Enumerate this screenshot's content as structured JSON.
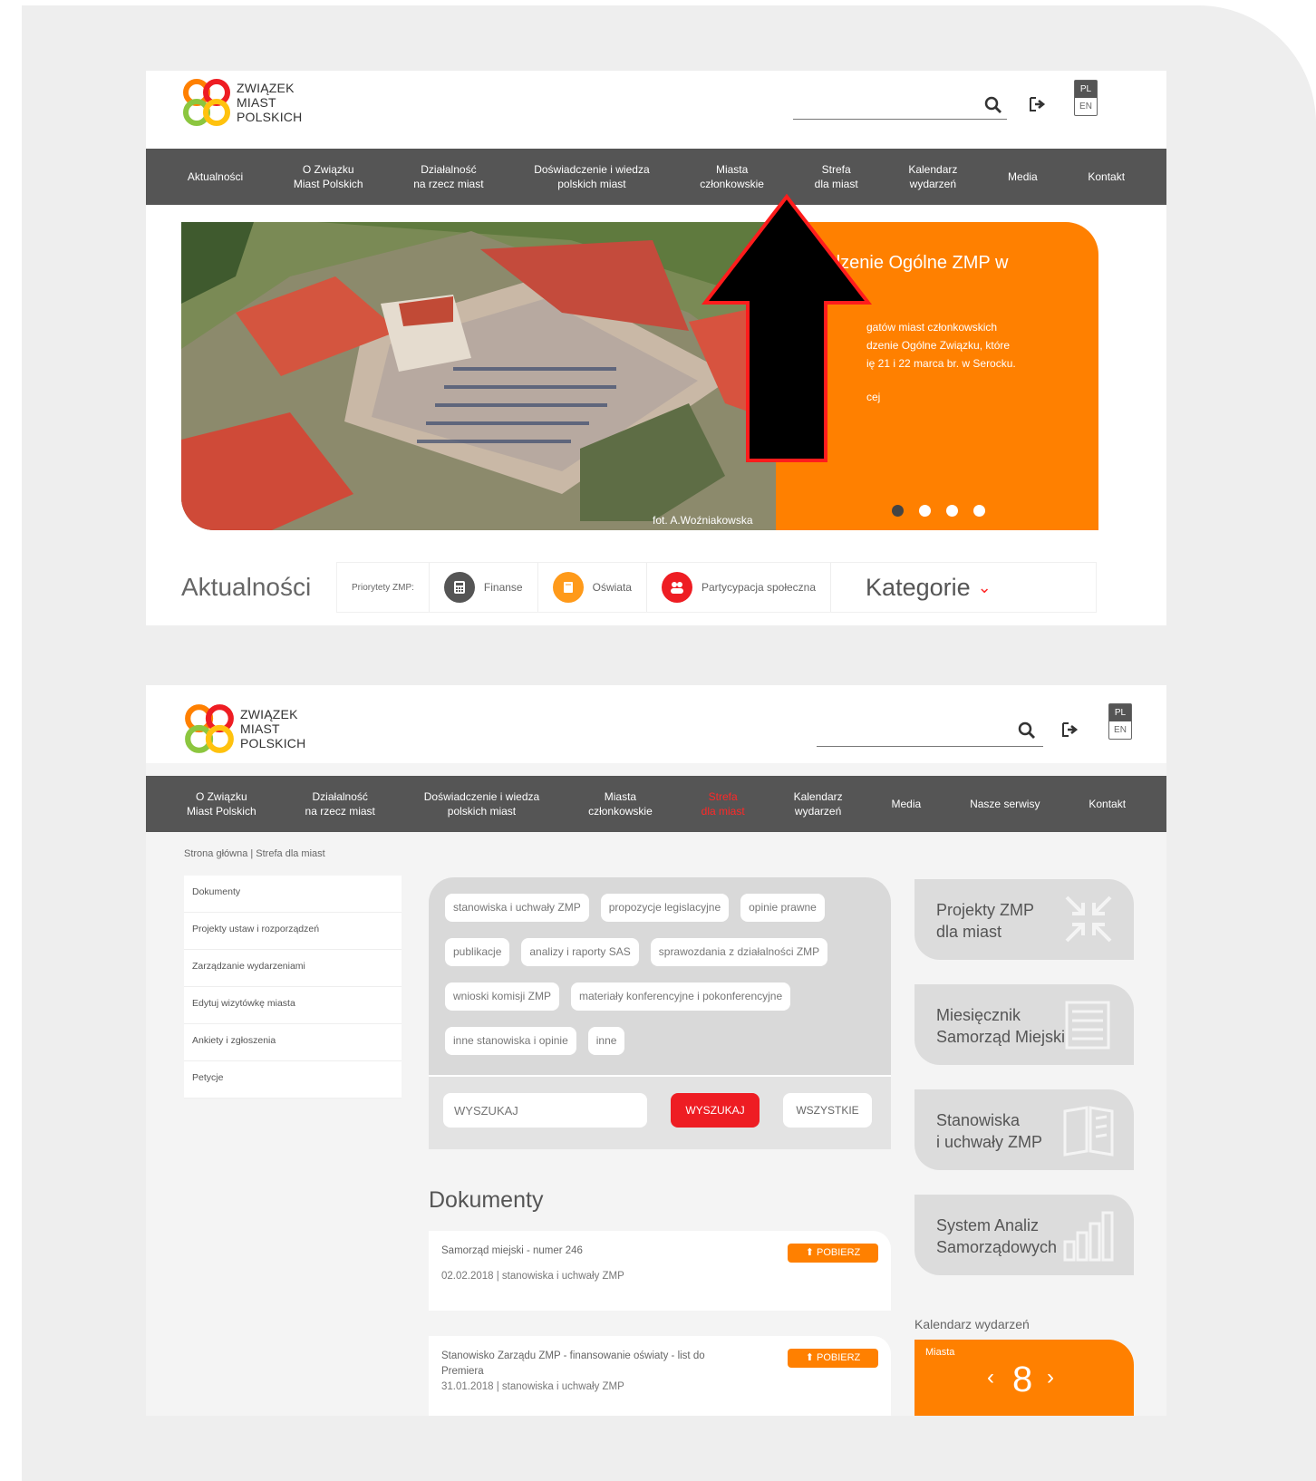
{
  "header": {
    "logo_lines": [
      "ZWIĄZEK",
      "MIAST",
      "POLSKICH"
    ],
    "lang_pl": "PL",
    "lang_en": "EN"
  },
  "nav1": [
    "Aktualności",
    "O Związku\nMiast Polskich",
    "Działalność\nna rzecz miast",
    "Doświadczenie i wiedza\npolskich miast",
    "Miasta\nczłonkowskie",
    "Strefa\ndla miast",
    "Kalendarz\nwydarzeń",
    "Media",
    "Kontakt"
  ],
  "nav2": [
    "O Związku\nMiast Polskich",
    "Działalność\nna rzecz miast",
    "Doświadczenie i wiedza\npolskich miast",
    "Miasta\nczłonkowskie",
    "Strefa\ndla miast",
    "Kalendarz\nwydarzeń",
    "Media",
    "Nasze serwisy",
    "Kontakt"
  ],
  "hero": {
    "title": "dzenie Ogólne ZMP w",
    "text": "gatów miast członkowskich\ndzenie Ogólne Związku, które\nię 21 i 22 marca br. w Serocku.",
    "more": "cej",
    "credit": "fot. A.Woźniakowska"
  },
  "news": {
    "title": "Aktualności",
    "categories": [
      "Priorytety ZMP:",
      "Finanse",
      "Oświata",
      "Partycypacja społeczna"
    ],
    "kategorie": "Kategorie"
  },
  "breadcrumb": "Strona główna  |  Strefa dla miast",
  "side_menu": [
    "Dokumenty",
    "Projekty ustaw i rozporządzeń",
    "Zarządzanie wydarzeniami",
    "Edytuj wizytówkę miasta",
    "Ankiety i zgłoszenia",
    "Petycje"
  ],
  "tags": [
    "stanowiska i uchwały ZMP",
    "propozycje legislacyjne",
    "opinie prawne",
    "publikacje",
    "analizy i raporty SAS",
    "sprawozdania z działalności ZMP",
    "wnioski komisji ZMP",
    "materiały konferencyjne i pokonferencyjne",
    "inne stanowiska i opinie",
    "inne"
  ],
  "search": {
    "placeholder": "WYSZUKAJ",
    "button": "WYSZUKAJ",
    "all": "WSZYSTKIE"
  },
  "documents": {
    "title": "Dokumenty",
    "download": "POBIERZ",
    "items": [
      {
        "title": "Samorząd miejski - numer 246",
        "meta": "02.02.2018 | stanowiska i uchwały ZMP"
      },
      {
        "title": "Stanowisko Zarządu ZMP - finansowanie oświaty - list do\nPremiera",
        "meta": "31.01.2018 | stanowiska i uchwały ZMP"
      }
    ]
  },
  "right_cards": [
    "Projekty ZMP\ndla miast",
    "Miesięcznik\nSamorząd Miejski",
    "Stanowiska\ni uchwały ZMP",
    "System Analiz\nSamorządowych"
  ],
  "calendar": {
    "label": "Kalendarz wydarzeń",
    "city": "Miasta",
    "day": "8",
    "prev": "‹",
    "next": "›"
  },
  "colors": {
    "nav_bg": "#555555",
    "accent_orange": "#ff8000",
    "accent_red": "#ee1d23"
  }
}
